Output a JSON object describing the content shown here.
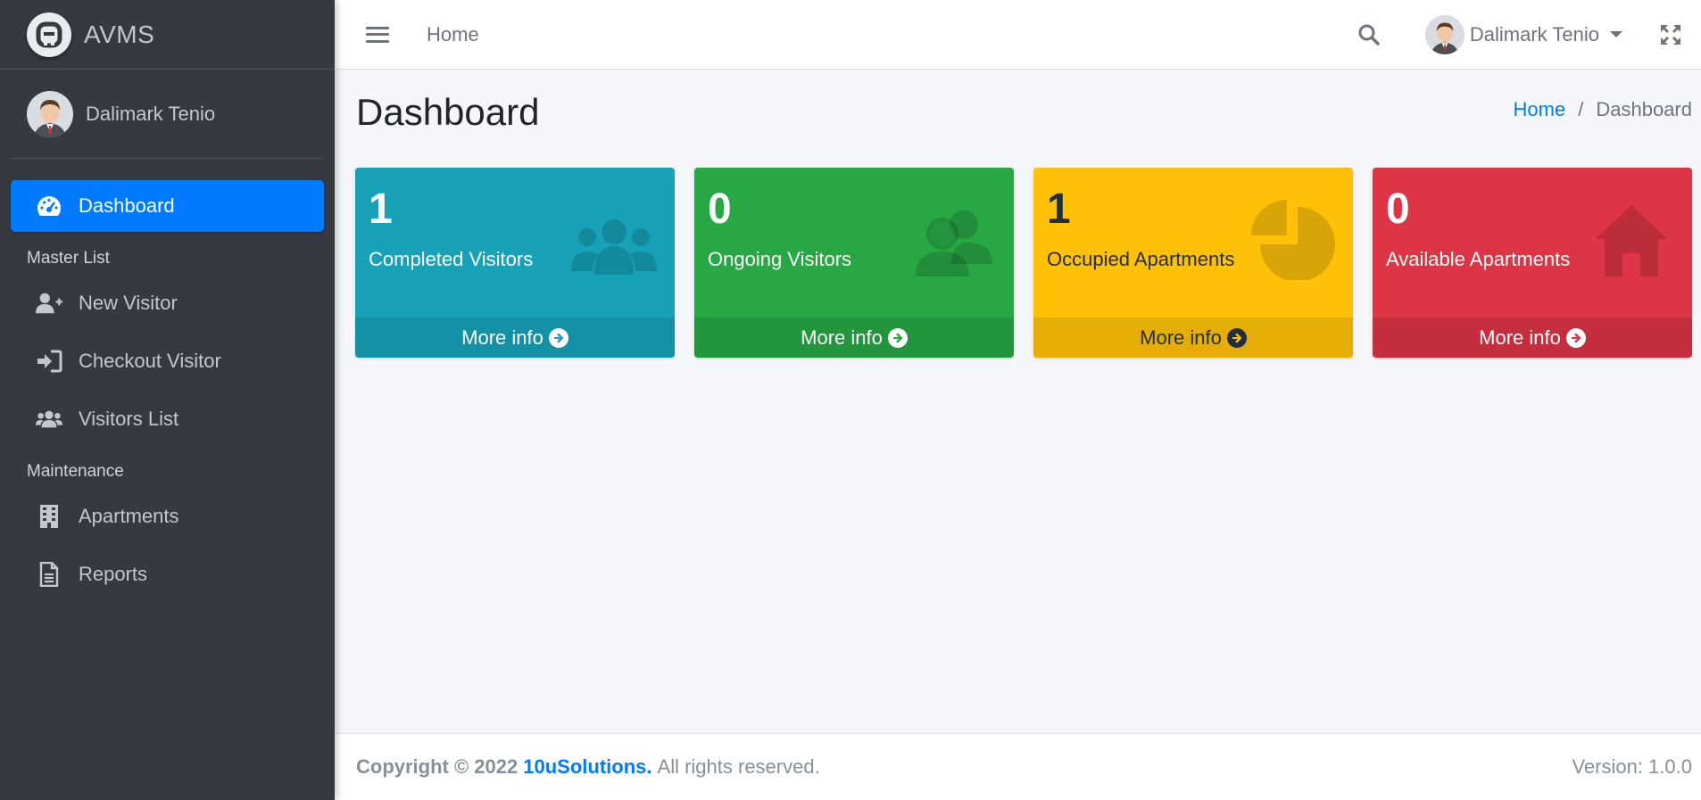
{
  "brand": {
    "name": "AVMS",
    "logo_icon": "logo-icon"
  },
  "sidebar": {
    "user_name": "Dalimark Tenio",
    "items": [
      {
        "label": "Dashboard",
        "icon": "tachometer-icon",
        "active": true
      },
      {
        "header": "Master List"
      },
      {
        "label": "New Visitor",
        "icon": "user-plus-icon"
      },
      {
        "label": "Checkout Visitor",
        "icon": "sign-in-icon"
      },
      {
        "label": "Visitors List",
        "icon": "users-icon"
      },
      {
        "header": "Maintenance"
      },
      {
        "label": "Apartments",
        "icon": "building-icon"
      },
      {
        "label": "Reports",
        "icon": "file-icon"
      }
    ]
  },
  "navbar": {
    "home_label": "Home",
    "user_name": "Dalimark Tenio"
  },
  "content": {
    "title": "Dashboard",
    "breadcrumb": {
      "home": "Home",
      "separator": "/",
      "current": "Dashboard"
    },
    "boxes": [
      {
        "count": "1",
        "label": "Completed Visitors",
        "footer": "More info",
        "color": "#17a2b8",
        "icon": "users-icon"
      },
      {
        "count": "0",
        "label": "Ongoing Visitors",
        "footer": "More info",
        "color": "#28a745",
        "icon": "user-friends-icon"
      },
      {
        "count": "1",
        "label": "Occupied Apartments",
        "footer": "More info",
        "color": "#ffc107",
        "icon": "pie-chart-icon"
      },
      {
        "count": "0",
        "label": "Available Apartments",
        "footer": "More info",
        "color": "#dc3545",
        "icon": "home-icon"
      }
    ]
  },
  "footer": {
    "copyright": "Copyright © 2022",
    "company": "10uSolutions.",
    "rights": "All rights reserved.",
    "version": "Version: 1.0.0"
  },
  "colors": {
    "sidebar_bg": "#343a40",
    "primary": "#007bff",
    "content_bg": "#f4f6f9"
  }
}
